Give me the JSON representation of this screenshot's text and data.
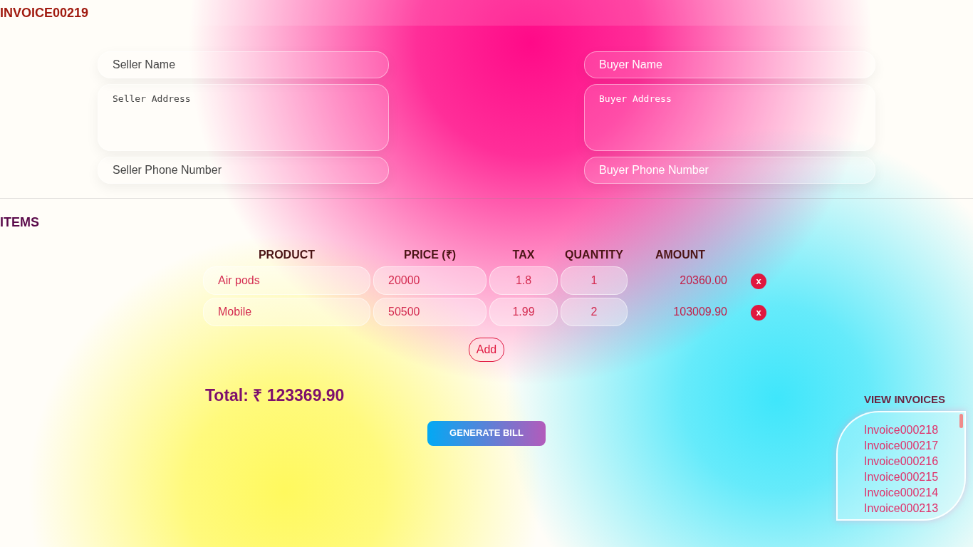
{
  "title": "INVOICE00219",
  "seller": {
    "name": {
      "placeholder": "Seller Name"
    },
    "address": {
      "placeholder": "Seller Address"
    },
    "phone": {
      "placeholder": "Seller Phone Number"
    }
  },
  "buyer": {
    "name": {
      "placeholder": "Buyer Name"
    },
    "address": {
      "placeholder": "Buyer Address"
    },
    "phone": {
      "placeholder": "Buyer Phone Number"
    }
  },
  "items_heading": "ITEMS",
  "table": {
    "columns": [
      "PRODUCT",
      "PRICE (₹)",
      "TAX",
      "QUANTITY",
      "AMOUNT"
    ],
    "rows": [
      {
        "product": "Air pods",
        "price": "20000",
        "tax": "1.8",
        "quantity": "1",
        "amount": "20360.00",
        "remove": "x"
      },
      {
        "product": "Mobile",
        "price": "50500",
        "tax": "1.99",
        "quantity": "2",
        "amount": "103009.90",
        "remove": "x"
      }
    ]
  },
  "add_button": "Add",
  "total": "Total: ₹ 123369.90",
  "generate_button": "GENERATE BILL",
  "invoices": {
    "heading": "VIEW INVOICES",
    "items": [
      "Invoice000218",
      "Invoice000217",
      "Invoice000216",
      "Invoice000215",
      "Invoice000214",
      "Invoice000213"
    ]
  }
}
